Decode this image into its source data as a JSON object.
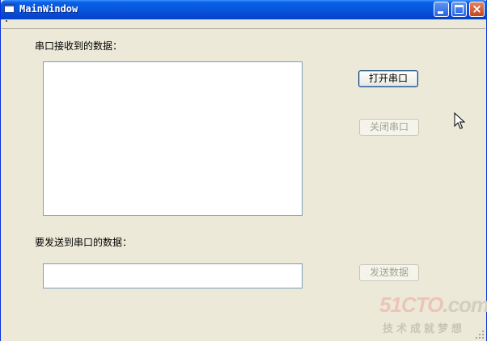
{
  "window": {
    "title": "MainWindow",
    "controls": {
      "minimize": "minimize-icon",
      "maximize": "maximize-icon",
      "close": "×"
    }
  },
  "form": {
    "receive_label": "串口接收到的数据：",
    "send_label": "要发送到串口的数据：",
    "receive_text": "",
    "send_text": ""
  },
  "buttons": {
    "open_port": "打开串口",
    "close_port": "关闭串口",
    "send_data": "发送数据"
  },
  "watermark": {
    "logo_main": "51CTO",
    "logo_suffix": ".com",
    "tagline": "技术成就梦想"
  },
  "colors": {
    "accent": "#0a5fe8",
    "background": "#ece9d8",
    "disabled_text": "#a6a394",
    "watermark_red": "#ecc4b8"
  }
}
